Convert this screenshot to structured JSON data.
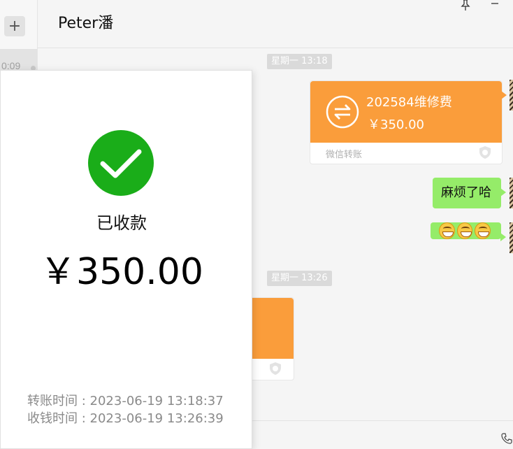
{
  "sidebar": {
    "add_label": "+",
    "session_time": "0:09"
  },
  "header": {
    "title": "Peter潘"
  },
  "messages": {
    "timestamp_1": "星期一 13:18",
    "timestamp_2": "星期一 13:26",
    "transfer": {
      "title": "202584维修费",
      "amount": "￥350.00",
      "footer": "微信转账"
    },
    "text_1": "麻烦了哈",
    "emoji_name": "grinning-face-emoji"
  },
  "receipt": {
    "status": "已收款",
    "amount": "￥350.00",
    "transfer_time_label": "转账时间",
    "transfer_time": "2023-06-19 13:18:37",
    "receive_time_label": "收钱时间",
    "receive_time": "2023-06-19 13:26:39"
  },
  "colors": {
    "transfer_orange": "#fa9d3b",
    "bubble_green": "#95ec69",
    "success_green": "#1aad19"
  }
}
